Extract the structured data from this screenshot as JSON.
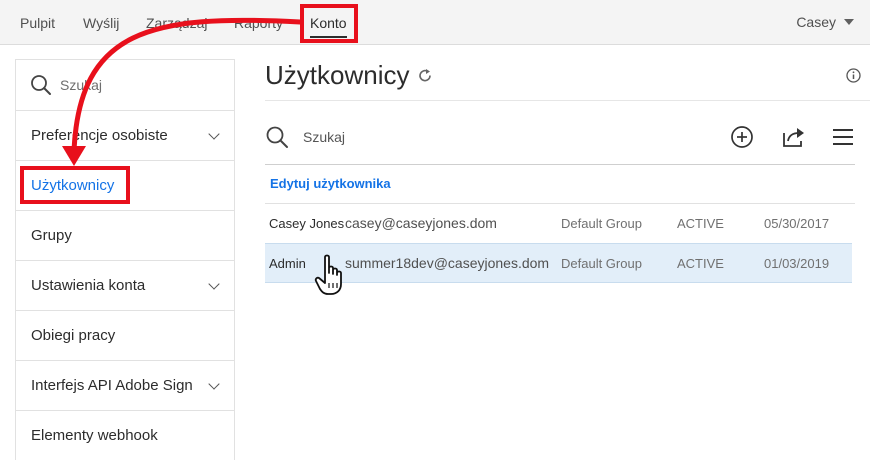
{
  "topnav": {
    "items": [
      {
        "label": "Pulpit"
      },
      {
        "label": "Wyślij"
      },
      {
        "label": "Zarządzaj"
      },
      {
        "label": "Raporty"
      },
      {
        "label": "Konto"
      }
    ],
    "user_name": "Casey"
  },
  "sidebar": {
    "search_placeholder": "Szukaj",
    "items": [
      {
        "label": "Preferencje osobiste"
      },
      {
        "label": "Użytkownicy"
      },
      {
        "label": "Grupy"
      },
      {
        "label": "Ustawienia konta"
      },
      {
        "label": "Obiegi pracy"
      },
      {
        "label": "Interfejs API Adobe Sign"
      },
      {
        "label": "Elementy webhook"
      }
    ]
  },
  "main": {
    "title": "Użytkownicy",
    "search_placeholder": "Szukaj",
    "edit_user_label": "Edytuj użytkownika",
    "users": [
      {
        "name": "Casey Jones",
        "email": "casey@caseyjones.dom",
        "group": "Default Group",
        "status": "ACTIVE",
        "date": "05/30/2017"
      },
      {
        "name": "Admin",
        "email": "summer18dev@caseyjones.dom",
        "group": "Default Group",
        "status": "ACTIVE",
        "date": "01/03/2019"
      }
    ]
  },
  "icons": {
    "refresh": "refresh-icon",
    "info": "info-icon",
    "add": "add-circle-icon",
    "share": "share-icon",
    "menu": "hamburger-menu-icon",
    "search": "search-icon",
    "cursor": "hand-pointer-icon"
  },
  "colors": {
    "accent": "#1473e6",
    "annotation": "#e8101c",
    "row_highlight": "#e2eef9"
  }
}
